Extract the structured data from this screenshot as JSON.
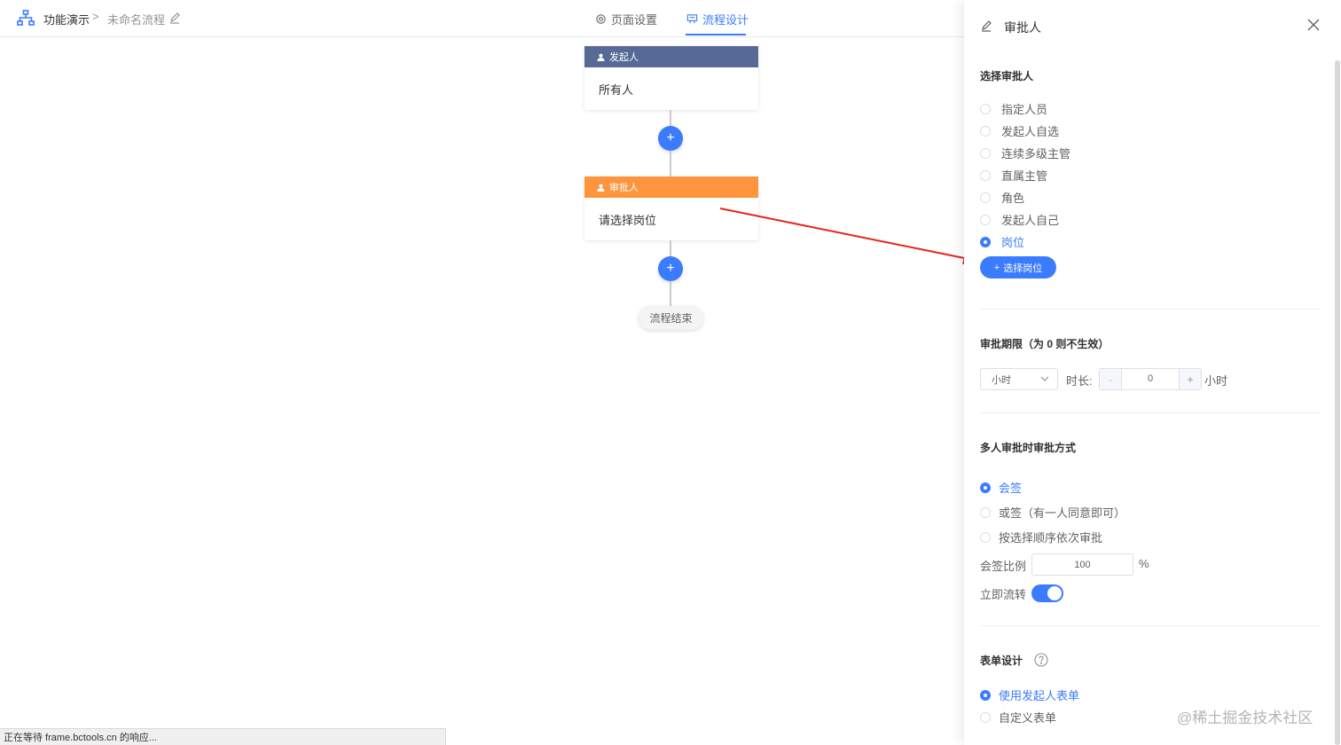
{
  "header": {
    "app_name": "功能演示",
    "breadcrumb_sep": ">",
    "flow_name": "未命名流程",
    "tabs": [
      {
        "label": "页面设置",
        "active": false
      },
      {
        "label": "流程设计",
        "active": true
      }
    ]
  },
  "canvas": {
    "initiator": {
      "title": "发起人",
      "content": "所有人"
    },
    "approver": {
      "title": "审批人",
      "content": "请选择岗位"
    },
    "add_symbol": "+",
    "end_label": "流程结束"
  },
  "drawer": {
    "title": "审批人",
    "approver_section": {
      "title": "选择审批人",
      "options": [
        "指定人员",
        "发起人自选",
        "连续多级主管",
        "直属主管",
        "角色",
        "发起人自己",
        "岗位"
      ],
      "selected": "岗位",
      "pick_button": "选择岗位",
      "pick_button_icon": "+"
    },
    "deadline_section": {
      "title": "审批期限（为 0 则不生效）",
      "unit_select": "小时",
      "duration_label": "时长:",
      "duration_value": "0",
      "minus": "-",
      "plus": "+",
      "unit_suffix": "小时"
    },
    "multi_section": {
      "title": "多人审批时审批方式",
      "options": [
        "会签",
        "或签（有一人同意即可）",
        "按选择顺序依次审批"
      ],
      "selected": "会签",
      "ratio_label": "会签比例",
      "ratio_value": "100",
      "ratio_unit": "%",
      "flow_label": "立即流转",
      "flow_on": true
    },
    "form_section": {
      "title": "表单设计",
      "options": [
        "使用发起人表单",
        "自定义表单"
      ],
      "selected": "使用发起人表单"
    }
  },
  "watermark": "@稀土掘金技术社区",
  "statusbar": "正在等待 frame.bctools.cn 的响应...",
  "colors": {
    "primary": "#3a7bff",
    "initiator_header": "#576a95",
    "approver_header": "#ff943e",
    "annotation_arrow": "#e8231e"
  }
}
